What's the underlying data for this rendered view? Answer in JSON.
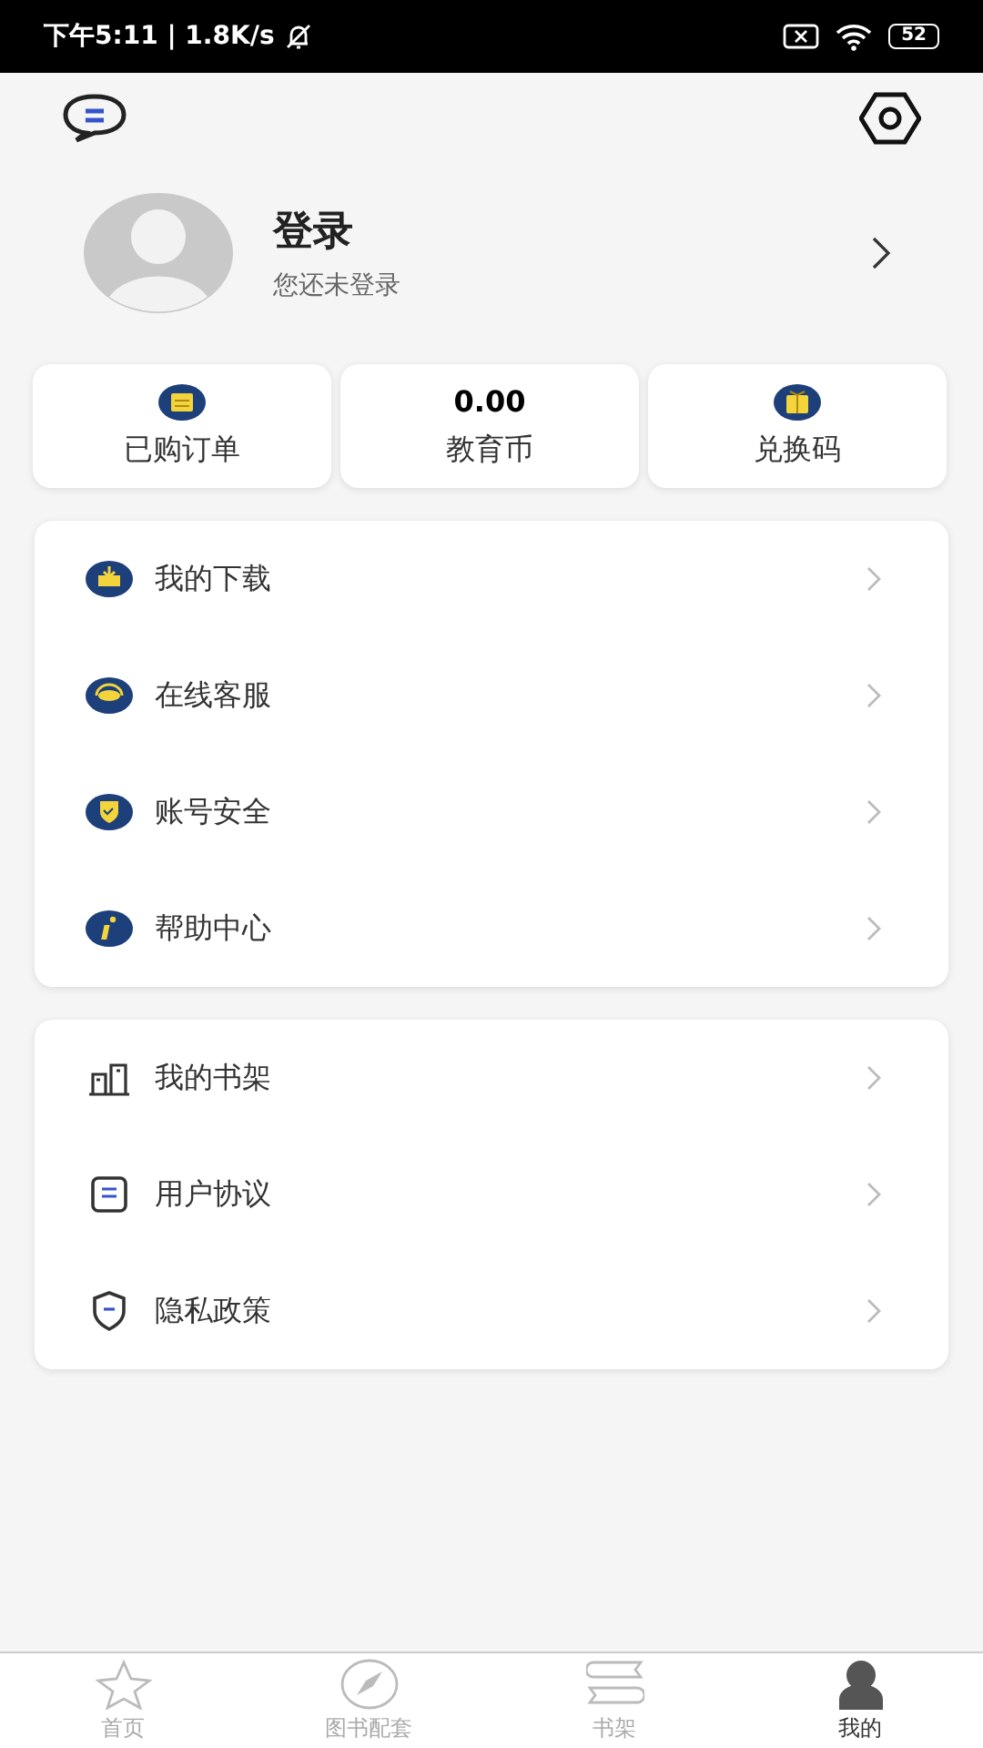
{
  "status_bar": {
    "time": "下午5:11 | 1.8K/s",
    "battery": "52"
  },
  "profile": {
    "name": "登录",
    "subtitle": "您还未登录"
  },
  "stats": [
    {
      "label": "已购订单"
    },
    {
      "value": "0.00",
      "label": "教育币"
    },
    {
      "label": "兑换码"
    }
  ],
  "menu_groups": [
    {
      "kind": "colored",
      "items": [
        {
          "label": "我的下载"
        },
        {
          "label": "在线客服"
        },
        {
          "label": "账号安全"
        },
        {
          "label": "帮助中心"
        }
      ]
    },
    {
      "kind": "outline",
      "items": [
        {
          "label": "我的书架"
        },
        {
          "label": "用户协议"
        },
        {
          "label": "隐私政策"
        }
      ]
    }
  ],
  "tabs": [
    {
      "label": "首页",
      "selected": false
    },
    {
      "label": "图书配套",
      "selected": false
    },
    {
      "label": "书架",
      "selected": false
    },
    {
      "label": "我的",
      "selected": true
    }
  ]
}
